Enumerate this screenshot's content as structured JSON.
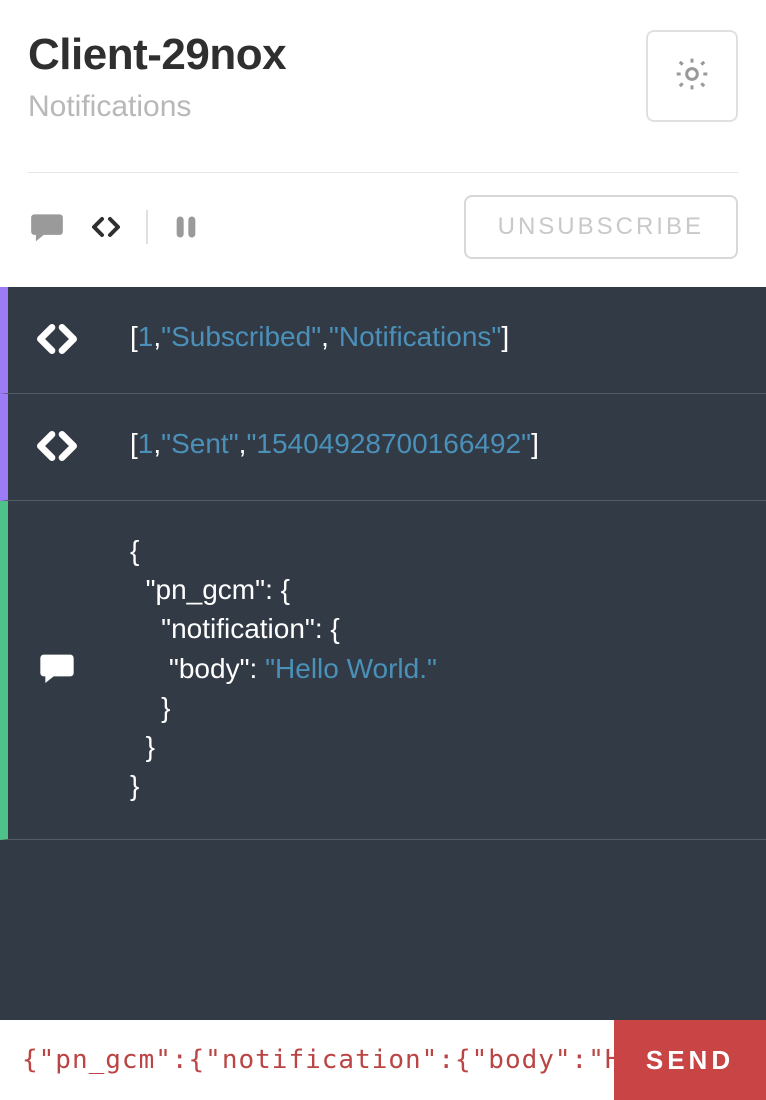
{
  "header": {
    "title": "Client-29nox",
    "subtitle": "Notifications"
  },
  "toolbar": {
    "unsubscribe_label": "UNSUBSCRIBE"
  },
  "accent_colors": {
    "system_event": "#9b7cf5",
    "incoming_message": "#4fc28a"
  },
  "messages": [
    {
      "kind": "system",
      "icon": "code",
      "accent": "purple",
      "array": [
        1,
        "Subscribed",
        "Notifications"
      ]
    },
    {
      "kind": "system",
      "icon": "code",
      "accent": "purple",
      "array": [
        1,
        "Sent",
        "15404928700166492"
      ]
    },
    {
      "kind": "payload",
      "icon": "chat",
      "accent": "green",
      "json": {
        "pn_gcm": {
          "notification": {
            "body": "Hello World."
          }
        }
      }
    }
  ],
  "composer": {
    "value": "{\"pn_gcm\":{\"notification\":{\"body\":\"Hello World.\"}}}",
    "send_label": "SEND"
  }
}
